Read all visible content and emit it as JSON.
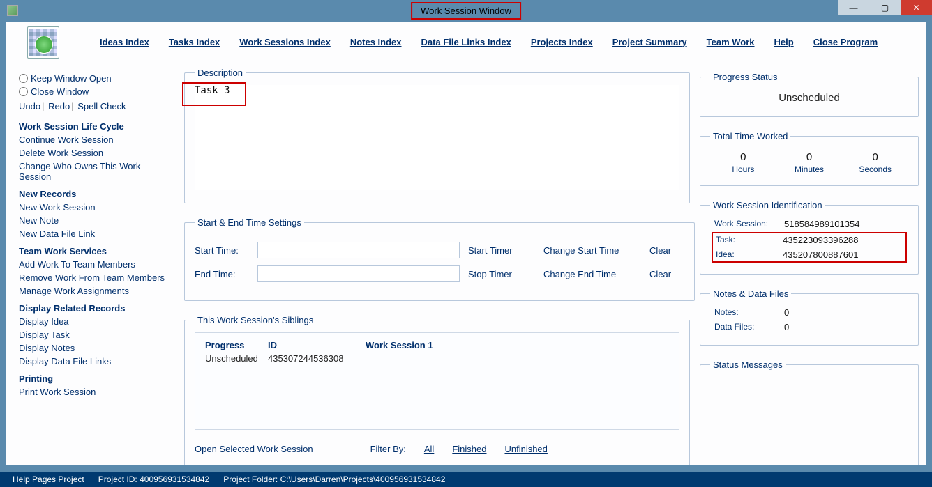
{
  "window": {
    "title": "Work Session Window"
  },
  "menu": {
    "ideas": "Ideas Index",
    "tasks": "Tasks Index",
    "worksessions": "Work Sessions Index",
    "notes": "Notes Index",
    "datafilelinks": "Data File Links Index",
    "projects": "Projects Index",
    "summary": "Project Summary",
    "teamwork": "Team Work",
    "help": "Help",
    "close": "Close Program"
  },
  "sidebar": {
    "keep_open": "Keep Window Open",
    "close_window": "Close Window",
    "undo": "Undo",
    "redo": "Redo",
    "spell": "Spell Check",
    "g_lifecycle": "Work Session Life Cycle",
    "lc": {
      "continue": "Continue Work Session",
      "delete": "Delete Work Session",
      "change_owner": "Change Who Owns This Work Session"
    },
    "g_newrec": "New Records",
    "nr": {
      "new_ws": "New Work Session",
      "new_note": "New Note",
      "new_dfl": "New Data File Link"
    },
    "g_team": "Team Work Services",
    "tw": {
      "add": "Add Work To Team Members",
      "remove": "Remove Work From Team Members",
      "manage": "Manage Work Assignments"
    },
    "g_related": "Display Related Records",
    "rel": {
      "idea": "Display Idea",
      "task": "Display Task",
      "notes": "Display Notes",
      "dfl": "Display Data File Links"
    },
    "g_print": "Printing",
    "pr": {
      "print": "Print Work Session"
    }
  },
  "desc": {
    "legend": "Description",
    "value": "Task 3"
  },
  "times": {
    "legend": "Start & End Time Settings",
    "start_label": "Start Time:",
    "start_value": "",
    "end_label": "End Time:",
    "end_value": "",
    "start_timer": "Start Timer",
    "stop_timer": "Stop Timer",
    "change_start": "Change Start Time",
    "change_end": "Change End Time",
    "clear": "Clear"
  },
  "siblings": {
    "legend": "This Work Session's Siblings",
    "cols": {
      "progress": "Progress",
      "id": "ID"
    },
    "rows": [
      {
        "progress": "Unscheduled",
        "id": "435307244536308",
        "name": "Work Session 1"
      }
    ],
    "open_selected": "Open Selected Work Session",
    "filter_label": "Filter By:",
    "filter_all": "All",
    "filter_finished": "Finished",
    "filter_unfinished": "Unfinished"
  },
  "right": {
    "status_legend": "Progress Status",
    "status_value": "Unscheduled",
    "ttw_legend": "Total Time Worked",
    "ttw": {
      "hours": "0",
      "hours_l": "Hours",
      "minutes": "0",
      "minutes_l": "Minutes",
      "seconds": "0",
      "seconds_l": "Seconds"
    },
    "ident_legend": "Work Session Identification",
    "ident": {
      "ws_k": "Work Session:",
      "ws_v": "518584989101354",
      "task_k": "Task:",
      "task_v": "435223093396288",
      "idea_k": "Idea:",
      "idea_v": "435207800887601"
    },
    "notes_legend": "Notes & Data Files",
    "notes": {
      "notes_k": "Notes:",
      "notes_v": "0",
      "df_k": "Data Files:",
      "df_v": "0"
    },
    "statusmsg_legend": "Status Messages"
  },
  "footer": {
    "help": "Help Pages Project",
    "pid_label": "Project ID:",
    "pid_value": "400956931534842",
    "folder_label": "Project Folder:",
    "folder_value": "C:\\Users\\Darren\\Projects\\400956931534842"
  }
}
